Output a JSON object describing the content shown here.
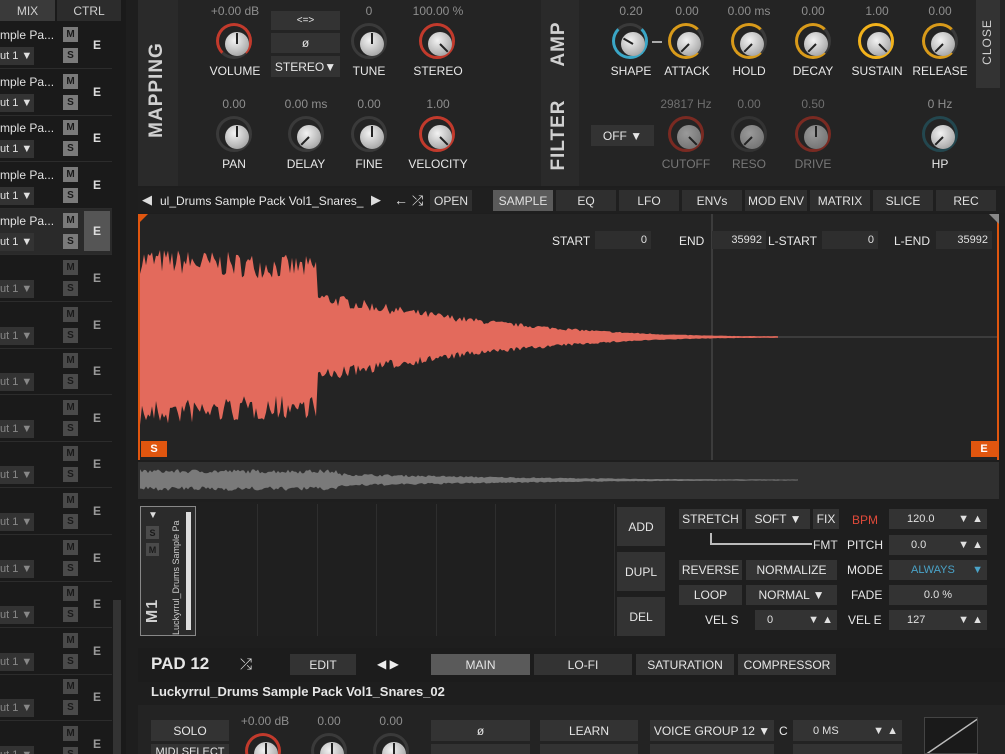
{
  "left": {
    "tabs": {
      "mix": "MIX",
      "ctrl": "CTRL"
    },
    "rows": [
      {
        "name": "mple Pa...",
        "out": "ut 1 ▼",
        "m": "M",
        "s": "S",
        "e": "E"
      },
      {
        "name": "mple Pa...",
        "out": "ut 1 ▼",
        "m": "M",
        "s": "S",
        "e": "E"
      },
      {
        "name": "mple Pa...",
        "out": "ut 1 ▼",
        "m": "M",
        "s": "S",
        "e": "E"
      },
      {
        "name": "mple Pa...",
        "out": "ut 1 ▼",
        "m": "M",
        "s": "S",
        "e": "E"
      },
      {
        "name": "mple Pa...",
        "out": "ut 1 ▼",
        "m": "M",
        "s": "S",
        "e": "E"
      },
      {
        "name": "",
        "out": "ut 1 ▼",
        "m": "M",
        "s": "S",
        "e": "E"
      },
      {
        "name": "",
        "out": "ut 1 ▼",
        "m": "M",
        "s": "S",
        "e": "E"
      },
      {
        "name": "",
        "out": "ut 1 ▼",
        "m": "M",
        "s": "S",
        "e": "E"
      },
      {
        "name": "",
        "out": "ut 1 ▼",
        "m": "M",
        "s": "S",
        "e": "E"
      },
      {
        "name": "",
        "out": "ut 1 ▼",
        "m": "M",
        "s": "S",
        "e": "E"
      },
      {
        "name": "",
        "out": "ut 1 ▼",
        "m": "M",
        "s": "S",
        "e": "E"
      },
      {
        "name": "",
        "out": "ut 1 ▼",
        "m": "M",
        "s": "S",
        "e": "E"
      },
      {
        "name": "",
        "out": "ut 1 ▼",
        "m": "M",
        "s": "S",
        "e": "E"
      },
      {
        "name": "",
        "out": "ut 1 ▼",
        "m": "M",
        "s": "S",
        "e": "E"
      },
      {
        "name": "",
        "out": "ut 1 ▼",
        "m": "M",
        "s": "S",
        "e": "E"
      },
      {
        "name": "",
        "out": "ut 1 ▼",
        "m": "M",
        "s": "S",
        "e": "E"
      }
    ]
  },
  "mapping": {
    "title": "MAPPING",
    "volume": {
      "value": "+0.00 dB",
      "label": "VOLUME"
    },
    "link_btn": "<=>",
    "phase_btn": "ø",
    "stereo_sel": "STEREO▼",
    "tune": {
      "value": "0",
      "label": "TUNE"
    },
    "stereo": {
      "value": "100.00 %",
      "label": "STEREO"
    },
    "pan": {
      "value": "0.00",
      "label": "PAN"
    },
    "delay": {
      "value": "0.00 ms",
      "label": "DELAY"
    },
    "fine": {
      "value": "0.00",
      "label": "FINE"
    },
    "velocity": {
      "value": "1.00",
      "label": "VELOCITY"
    }
  },
  "amp": {
    "title": "AMP",
    "shape": {
      "value": "0.20",
      "label": "SHAPE"
    },
    "attack": {
      "value": "0.00",
      "label": "ATTACK"
    },
    "hold": {
      "value": "0.00 ms",
      "label": "HOLD"
    },
    "decay": {
      "value": "0.00",
      "label": "DECAY"
    },
    "sustain": {
      "value": "1.00",
      "label": "SUSTAIN"
    },
    "release": {
      "value": "0.00",
      "label": "RELEASE"
    },
    "close": "CLOSE"
  },
  "filter": {
    "title": "FILTER",
    "mode": "OFF ▼",
    "cutoff": {
      "value": "29817 Hz",
      "label": "CUTOFF"
    },
    "reso": {
      "value": "0.00",
      "label": "RESO"
    },
    "drive": {
      "value": "0.50",
      "label": "DRIVE"
    },
    "hp": {
      "value": "0 Hz",
      "label": "HP"
    }
  },
  "sample_bar": {
    "prev": "◀",
    "name": "ul_Drums Sample Pack Vol1_Snares_",
    "next": "▶",
    "back_icon": "←",
    "shuffle_icon": "⤮",
    "open": "OPEN",
    "tabs": [
      "SAMPLE",
      "EQ",
      "LFO",
      "ENVs",
      "MOD ENV",
      "MATRIX",
      "SLICE",
      "REC"
    ]
  },
  "waveform": {
    "start_label": "START",
    "start_value": "0",
    "end_label": "END",
    "end_value": "35992",
    "lstart_label": "L-START",
    "lstart_value": "0",
    "lend_label": "L-END",
    "lend_value": "35992",
    "s_marker": "S",
    "e_marker": "E",
    "color": "#e36a5c"
  },
  "slots": {
    "slot_label": "M1",
    "slot_name": "Luckyrrul_Drums Sample Pa",
    "slot_s": "S",
    "slot_m": "M",
    "slot_arrow": "▼",
    "add": "ADD",
    "dupl": "DUPL",
    "del": "DEL"
  },
  "settings": {
    "stretch": "STRETCH",
    "soft": "SOFT ▼",
    "fix": "FIX",
    "bpm": "BPM",
    "bpm_value": "120.0",
    "fmt": "FMT",
    "pitch": "PITCH",
    "pitch_value": "0.0",
    "reverse": "REVERSE",
    "normalize": "NORMALIZE",
    "mode": "MODE",
    "mode_value": "ALWAYS",
    "loop": "LOOP",
    "normal": "NORMAL ▼",
    "fade": "FADE",
    "fade_value": "0.0 %",
    "vels": "VEL S",
    "vels_value": "0",
    "vele": "VEL E",
    "vele_value": "127",
    "arrows": "▼ ▲"
  },
  "pad": {
    "title": "PAD 12",
    "shuffle_icon": "⤮",
    "edit": "EDIT",
    "nav": "◀ ▶",
    "tabs": [
      "MAIN",
      "LO-FI",
      "SATURATION",
      "COMPRESSOR"
    ],
    "sample_name": "Luckyrrul_Drums Sample Pack Vol1_Snares_02",
    "solo": "SOLO",
    "midi_select": "MIDI SELECT",
    "vol_value": "+0.00 dB",
    "k2_value": "0.00",
    "k3_value": "0.00",
    "phase": "ø",
    "learn": "LEARN",
    "voice_group": "VOICE GROUP 12 ▼",
    "c": "C",
    "ms": "0 MS",
    "arrows": "▼ ▲"
  },
  "colors": {
    "accent_red": "#e36a5c",
    "marker_orange": "#e0560f",
    "bpm_red": "#e04a3a",
    "mode_blue": "#4aa3c8",
    "sustain_gold": "#f2b21b"
  }
}
